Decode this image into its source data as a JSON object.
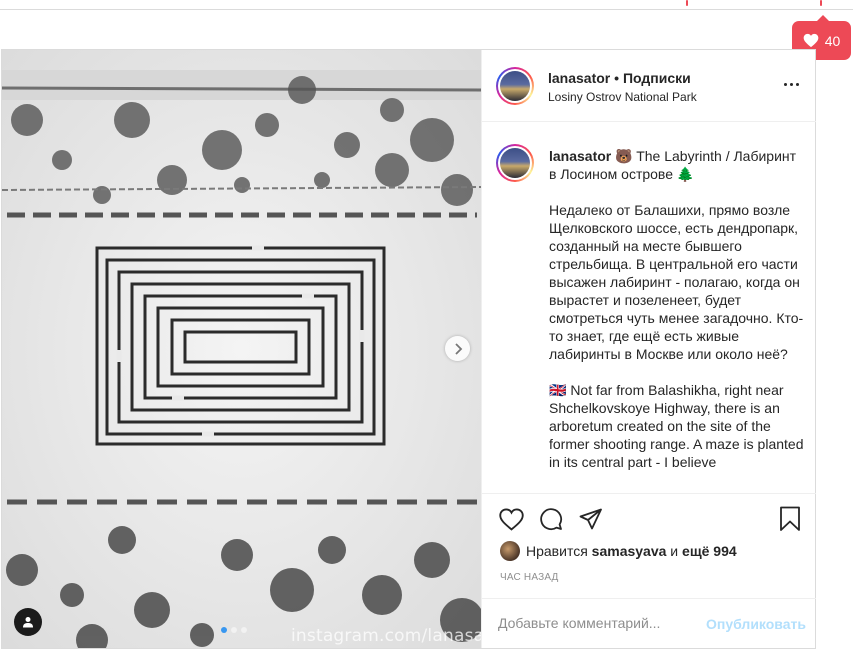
{
  "notification": {
    "icon": "heart-icon",
    "count": "40",
    "color": "#ed4956"
  },
  "post": {
    "media": {
      "watermark": "instagram.com/lanasator",
      "carousel_total": 3,
      "carousel_active": 1,
      "accent": "#3897f0"
    },
    "header": {
      "username": "lanasator",
      "separator": " • ",
      "follow_label": "Подписки",
      "location": "Losiny Ostrov National Park"
    },
    "caption": {
      "username": "lanasator",
      "title": " 🐻 The Labyrinth / Лабиринт в Лосином острове 🌲",
      "paragraph_ru": "Недалеко от Балашихи, прямо возле Щелковского шоссе, есть дендропарк, созданный на месте бывшего стрельбища. В центральной его части высажен лабиринт - полагаю, когда он вырастет и позеленеет, будет смотреться чуть менее загадочно. Кто-то знает, где ещё есть живые лабиринты в Москве или около неё?",
      "paragraph_en": "🇬🇧 Not far from Balashikha, right near Shchelkovskoye Highway, there is an arboretum created on the site of the former shooting range. A maze is planted in its central part - I believe"
    },
    "actions": {
      "icons": [
        "heart-outline-icon",
        "comment-icon",
        "share-icon",
        "bookmark-icon"
      ],
      "likes_prefix": "Нравится ",
      "likes_user": "samasyava",
      "likes_middle": " и ",
      "likes_others": "ещё 994",
      "time": "ЧАС НАЗАД"
    },
    "comment": {
      "placeholder": "Добавьте комментарий...",
      "publish_label": "Опубликовать",
      "publish_color": "#b2dffc"
    }
  }
}
